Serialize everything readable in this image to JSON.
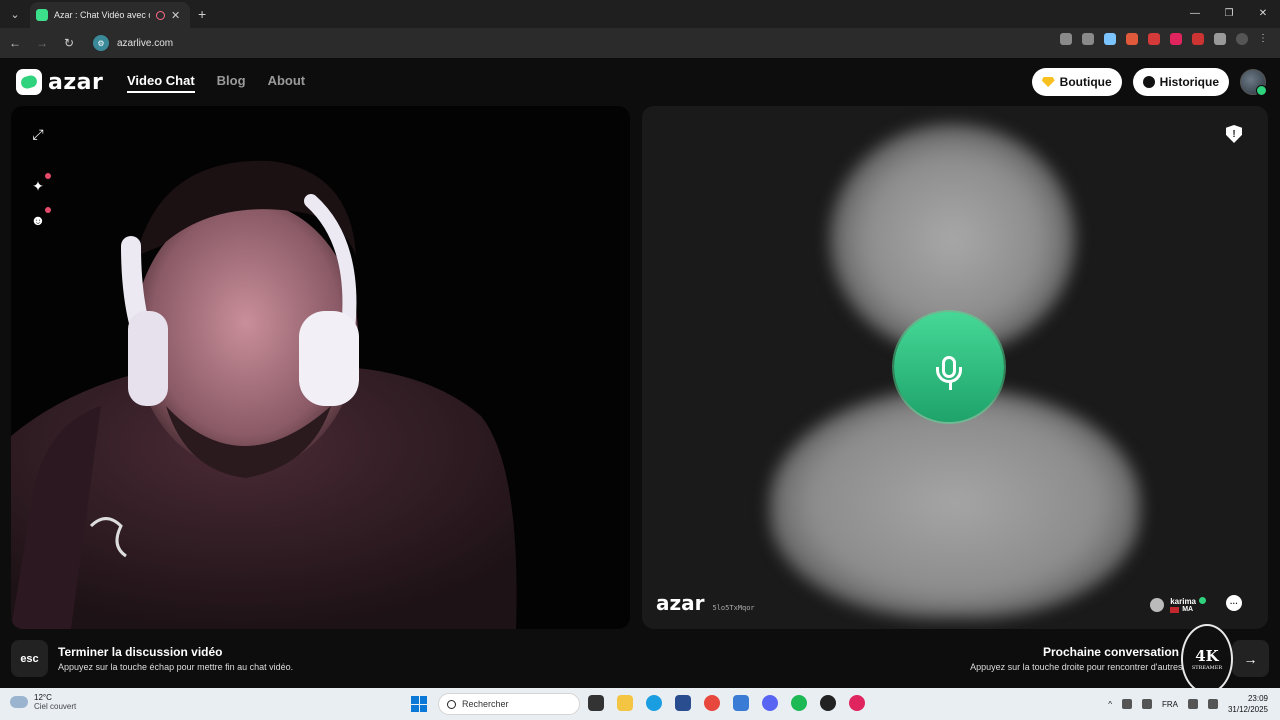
{
  "browser": {
    "tab_title": "Azar : Chat Vidéo avec de n",
    "url": "azarlive.com"
  },
  "header": {
    "logo_text": "azar",
    "nav": [
      {
        "label": "Video Chat"
      },
      {
        "label": "Blog"
      },
      {
        "label": "About"
      }
    ],
    "boutique_label": "Boutique",
    "historique_label": "Historique"
  },
  "remote": {
    "watermark": "azar",
    "session_id": "5lo5TxMqor",
    "peer_name": "karima",
    "peer_country": "MA"
  },
  "hints": {
    "esc_key": "esc",
    "end_title": "Terminer la discussion vidéo",
    "end_desc": "Appuyez sur la touche échap pour mettre fin au chat vidéo.",
    "next_title": "Prochaine conversation",
    "next_desc": "Appuyez sur la touche droite pour rencontrer d'autres per",
    "next_arrow": "→"
  },
  "overlay_badge": {
    "main": "4K",
    "sub": "STREAMER"
  },
  "taskbar": {
    "temp": "12°C",
    "weather": "Ciel couvert",
    "search_placeholder": "Rechercher",
    "lang": "FRA",
    "time": "23:09",
    "date": "31/12/2025"
  },
  "colors": {
    "accent_green": "#2fd27d",
    "background": "#0d0d0d"
  },
  "icons": [
    "expand-icon",
    "sparkle-effects-icon",
    "sticker-icon",
    "report-shield-icon",
    "microphone-icon",
    "chat-bubble-icon",
    "diamond-icon",
    "clock-icon"
  ]
}
